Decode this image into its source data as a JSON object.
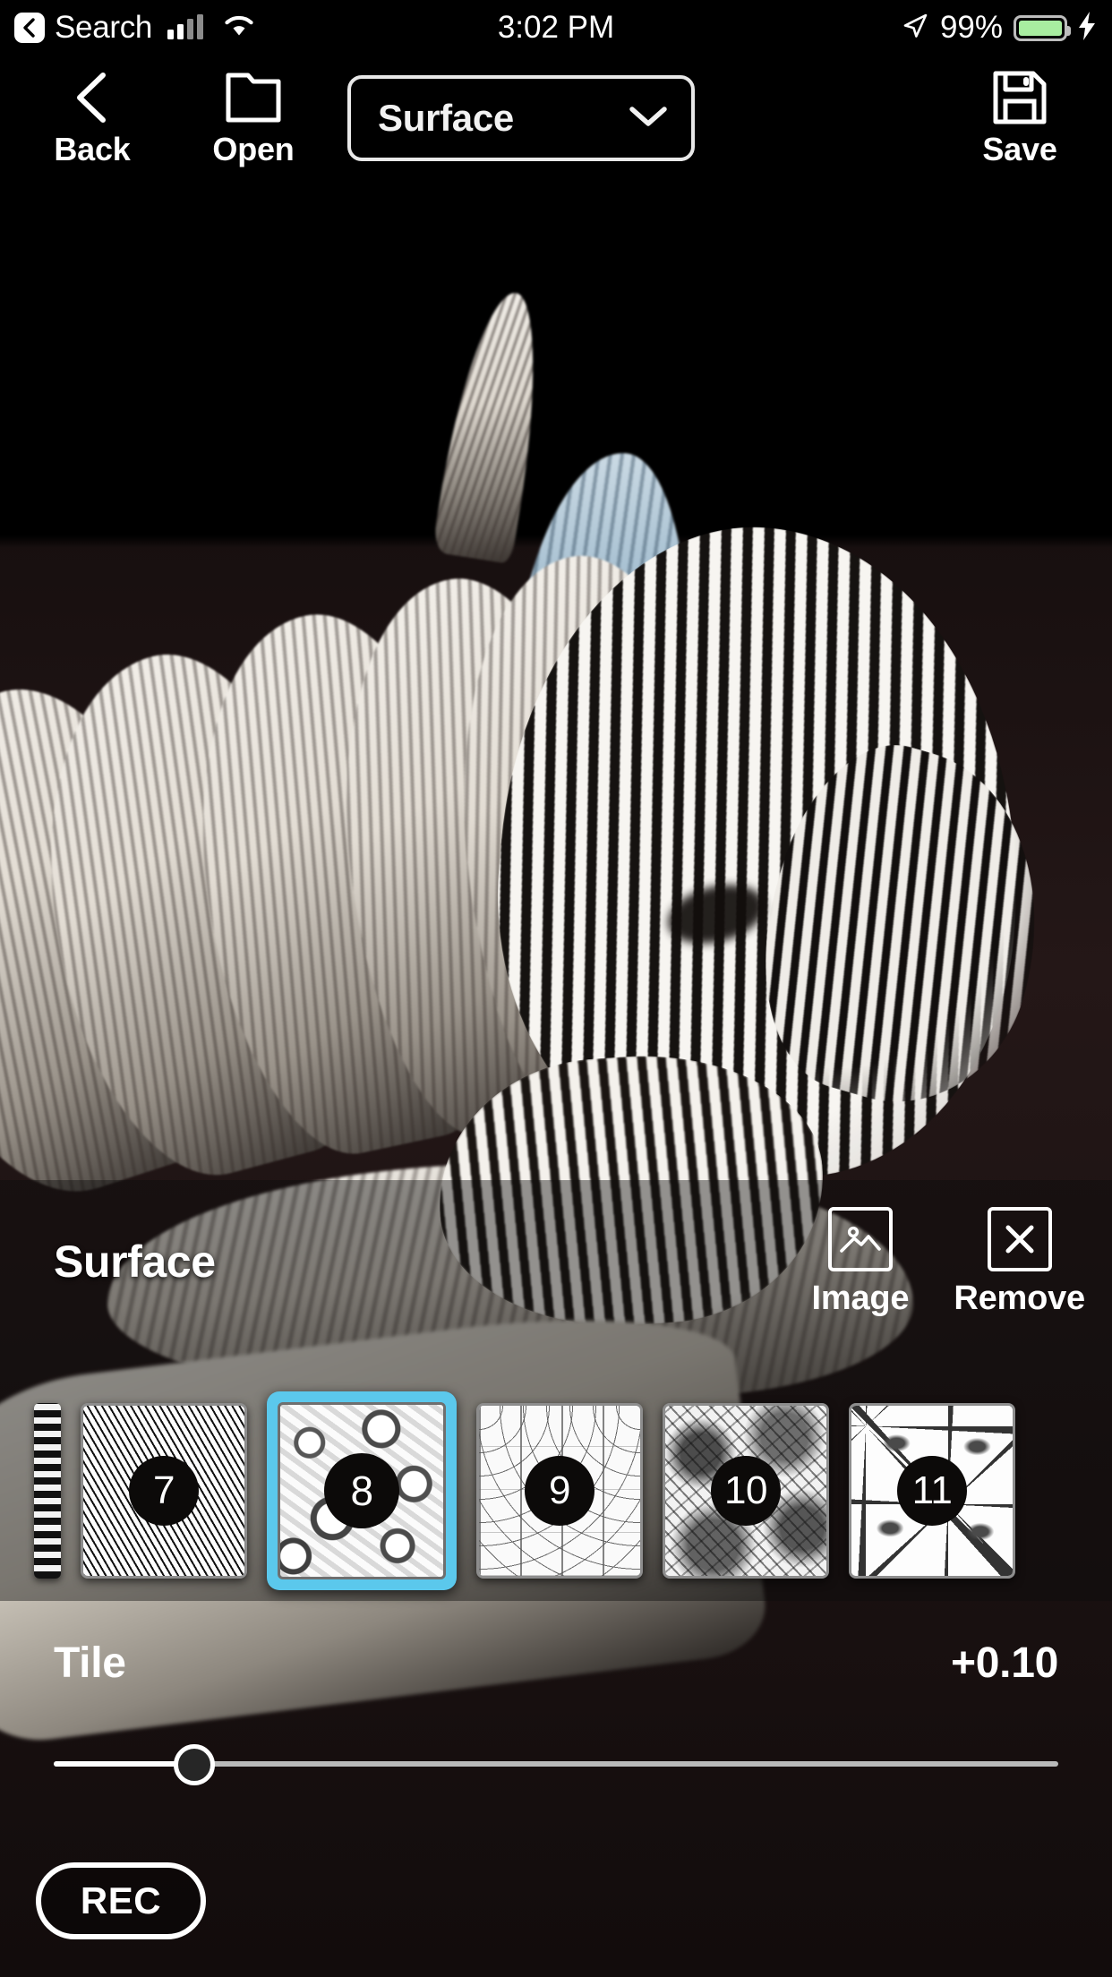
{
  "statusbar": {
    "back_chip_icon": "chevron-left-icon",
    "carrier": "Search",
    "signal_icon": "cellular-signal-icon",
    "wifi_icon": "wifi-icon",
    "time": "3:02 PM",
    "location_icon": "location-arrow-icon",
    "battery_percent": "99%",
    "battery_icon": "battery-icon",
    "charging_icon": "lightning-bolt-icon"
  },
  "toolbar": {
    "back_label": "Back",
    "back_icon": "chevron-left-icon",
    "open_label": "Open",
    "open_icon": "folder-icon",
    "save_label": "Save",
    "save_icon": "floppy-disk-icon",
    "dropdown": {
      "selected": "Surface",
      "chevron_icon": "chevron-down-icon",
      "options": [
        "Surface"
      ]
    }
  },
  "panel": {
    "title": "Surface",
    "actions": [
      {
        "label": "Image",
        "icon": "image-icon"
      },
      {
        "label": "Remove",
        "icon": "close-x-icon"
      }
    ]
  },
  "thumbnails": {
    "partial_left": true,
    "items": [
      {
        "number": "7",
        "texture": "tex-tri",
        "selected": false
      },
      {
        "number": "8",
        "texture": "tex-organic",
        "selected": true
      },
      {
        "number": "9",
        "texture": "tex-lattice",
        "selected": false
      },
      {
        "number": "10",
        "texture": "tex-grunge",
        "selected": false
      },
      {
        "number": "11",
        "texture": "tex-floral",
        "selected": false
      }
    ]
  },
  "slider": {
    "label": "Tile",
    "value": "+0.10",
    "position_percent": 14
  },
  "rec": {
    "label": "REC"
  },
  "colors": {
    "accent_selected": "#5bc8ec",
    "background": "#000000",
    "battery_green": "#a8eda0",
    "panel_overlay": "rgba(12,12,12,0.42)"
  }
}
